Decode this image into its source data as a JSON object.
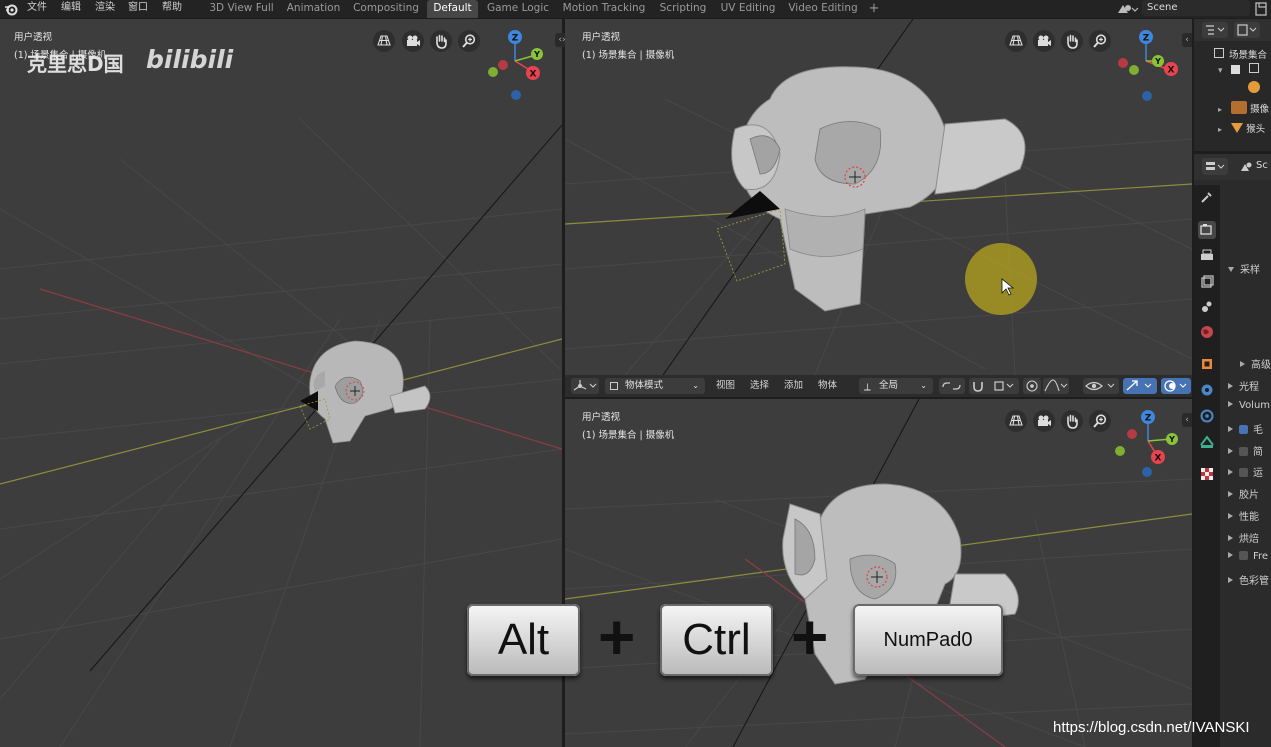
{
  "menubar": {
    "items": [
      "文件",
      "编辑",
      "渲染",
      "窗口",
      "帮助"
    ]
  },
  "workspace_tabs": [
    {
      "label": "3D View Full"
    },
    {
      "label": "Animation"
    },
    {
      "label": "Compositing"
    },
    {
      "label": "Default"
    },
    {
      "label": "Game Logic"
    },
    {
      "label": "Motion Tracking"
    },
    {
      "label": "Scripting"
    },
    {
      "label": "UV Editing"
    },
    {
      "label": "Video Editing"
    }
  ],
  "active_tab": "Default",
  "add_tab_label": "+",
  "scene": {
    "label": "Scene"
  },
  "viewports": {
    "left": {
      "view_name": "用户透视",
      "collection": "(1) 场景集合 | 摄像机"
    },
    "top_right": {
      "view_name": "用户透视",
      "collection": "(1) 场景集合 | 摄像机"
    },
    "bottom_right": {
      "view_name": "用户透视",
      "collection": "(1) 场景集合 | 摄像机"
    }
  },
  "gizmo_axes": {
    "z": "Z",
    "y": "Y",
    "x": "X"
  },
  "viewport_header": {
    "mode": "物体模式",
    "menus": [
      "视图",
      "选择",
      "添加",
      "物体"
    ],
    "transform_orientation": "全局"
  },
  "outliner": {
    "rows": [
      "场景集合",
      "",
      "",
      "摄像",
      "猴头"
    ]
  },
  "properties": {
    "rows": [
      {
        "label": "采样",
        "expanded": true
      },
      {
        "label": "高级",
        "expanded": false
      },
      {
        "label": "光程",
        "expanded": false
      },
      {
        "label": "Volum",
        "expanded": false
      },
      {
        "label": "毛",
        "expanded": false,
        "checkbox": true,
        "checked": true
      },
      {
        "label": "简",
        "expanded": false,
        "checkbox": true,
        "checked": false
      },
      {
        "label": "运",
        "expanded": false,
        "checkbox": true,
        "checked": false
      },
      {
        "label": "胶片",
        "expanded": false
      },
      {
        "label": "性能",
        "expanded": false
      },
      {
        "label": "烘焙",
        "expanded": false
      },
      {
        "label": "Fre",
        "expanded": false,
        "checkbox": true,
        "checked": false
      },
      {
        "label": "色彩管",
        "expanded": false
      }
    ],
    "header_label": "Sc"
  },
  "shortcut_overlay": {
    "keys": [
      "Alt",
      "Ctrl",
      "NumPad0"
    ],
    "separator": "+"
  },
  "watermark": {
    "channel": "克里思D国",
    "site": "bilibili",
    "url": "https://blog.csdn.net/IVANSKI"
  },
  "colors": {
    "viewport_bg": "#3d3d3d",
    "x_axis": "#e8434f",
    "y_axis": "#8ac338",
    "z_axis": "#3f86dd",
    "cursor_highlight": "#b7a51f"
  }
}
